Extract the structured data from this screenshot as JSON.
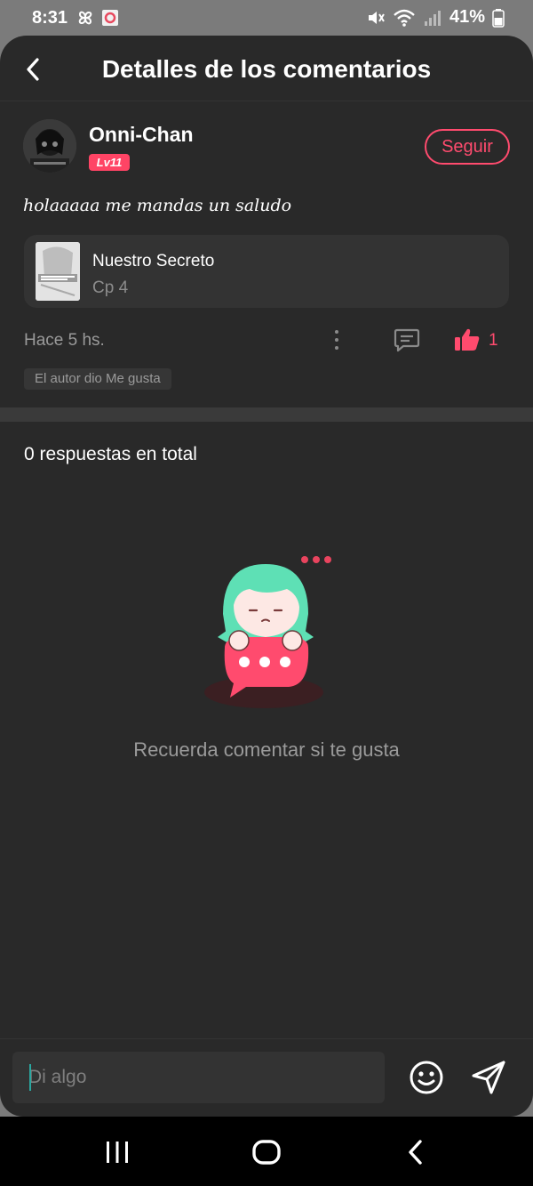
{
  "status_bar": {
    "time": "8:31",
    "battery": "41%"
  },
  "header": {
    "title": "Detalles de los comentarios"
  },
  "comment": {
    "username": "Onni-Chan",
    "level": "Lv11",
    "follow_label": "Seguir",
    "text": "holaaaaa me mandas un saludo",
    "work": {
      "title": "Nuestro Secreto",
      "chapter": "Cp 4"
    },
    "time_ago": "Hace 5 hs.",
    "like_count": "1",
    "author_liked": "El autor dio Me gusta"
  },
  "replies": {
    "total_label": "0 respuestas en total",
    "empty_message": "Recuerda comentar si te gusta"
  },
  "input": {
    "placeholder": "Di algo"
  },
  "colors": {
    "accent": "#ff4b6e",
    "background": "#292929",
    "card": "#333333"
  },
  "icons": {
    "back": "chevron-left-icon",
    "more": "more-vertical-icon",
    "reply": "message-icon",
    "like": "thumbs-up-icon",
    "emoji": "smile-icon",
    "send": "send-icon"
  }
}
